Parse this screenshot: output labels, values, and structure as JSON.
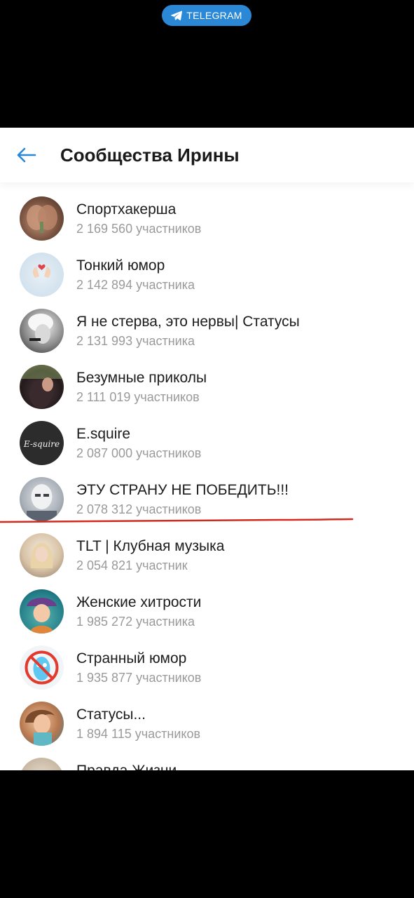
{
  "status_bar": {
    "pill_label": "TELEGRAM",
    "pill_color": "#2a88d6"
  },
  "header": {
    "back_icon": "arrow-left-icon",
    "title": "Сообщества Ирины",
    "accent_color": "#2a88d6"
  },
  "communities": [
    {
      "name": "Спортхакерша",
      "members": "2 169 560 участников"
    },
    {
      "name": "Тонкий юмор",
      "members": "2 142 894 участника"
    },
    {
      "name": "Я не стерва, это нервы| Статусы",
      "members": "2 131 993 участника"
    },
    {
      "name": "Безумные приколы",
      "members": "2 111 019 участников"
    },
    {
      "name": "E.squire",
      "members": "2 087 000 участников",
      "avatar_text": "E-squire"
    },
    {
      "name": "ЭТУ СТРАНУ НЕ ПОБЕДИТЬ!!!",
      "members": "2 078 312 участников"
    },
    {
      "name": "TLT | Клубная музыка",
      "members": "2 054 821 участник"
    },
    {
      "name": "Женские хитрости",
      "members": "1 985 272 участника"
    },
    {
      "name": "Странный юмор",
      "members": "1 935 877 участников"
    },
    {
      "name": "Статусы...",
      "members": "1 894 115 участников"
    },
    {
      "name": "Правда Жизни",
      "members": ""
    }
  ],
  "annotation": {
    "underline_color": "#d22a1e"
  }
}
